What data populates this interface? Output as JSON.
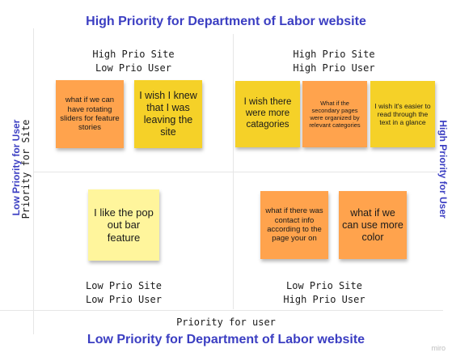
{
  "titles": {
    "top": "High Priority for Department of Labor website",
    "bottom": "Low Priority for Department of Labor website",
    "left": "Low Priority for User",
    "right": "High Priority for User"
  },
  "axes": {
    "x_label": "Priority for user",
    "y_label": "Priority for Site"
  },
  "quadrants": {
    "top_left": "High Prio Site\nLow Prio User",
    "top_right": "High Prio Site\nHigh Prio User",
    "bottom_left": "Low Prio Site\nLow Prio User",
    "bottom_right": "Low Prio Site\nHigh Prio User"
  },
  "stickies": {
    "rotating_sliders": "what if we can have rotating sliders for feature stories",
    "leaving_site": "I wish I knew that I was leaving the site",
    "more_categories": "I wish there were more catagories",
    "secondary_pages": "What if the secondary pages were organized by relevant categories",
    "easier_read": "I wish it's easier to read through the text in a glance",
    "pop_out_bar": "I like the pop out bar feature",
    "contact_info": "what if there was contact info according to the page your on",
    "more_color": "what if we can use more color"
  },
  "colors": {
    "title": "#3b3ec2",
    "orange": "#ffa34d",
    "yellow": "#f5d128",
    "pale_yellow": "#fff59c"
  },
  "watermark": "miro"
}
